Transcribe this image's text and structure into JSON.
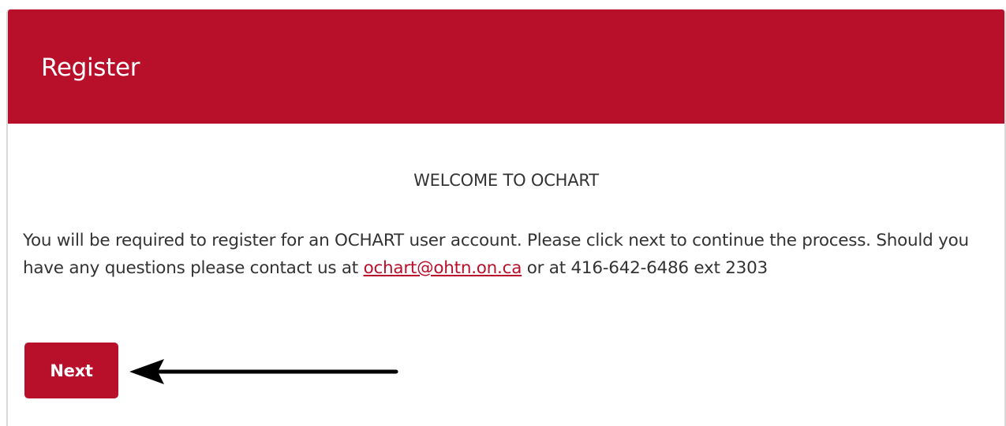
{
  "panel": {
    "title": "Register"
  },
  "content": {
    "welcome_heading": "WELCOME TO OCHART",
    "description_before_email": "You will be required to register for an OCHART user account. Please click next to continue the process. Should you have any questions please contact us at ",
    "contact_email": "ochart@ohtn.on.ca",
    "description_after_email": " or at 416-642-6486 ext 2303"
  },
  "actions": {
    "next_label": "Next"
  },
  "colors": {
    "brand_red": "#b8102b",
    "text": "#333333",
    "border": "#d9d9d9"
  }
}
